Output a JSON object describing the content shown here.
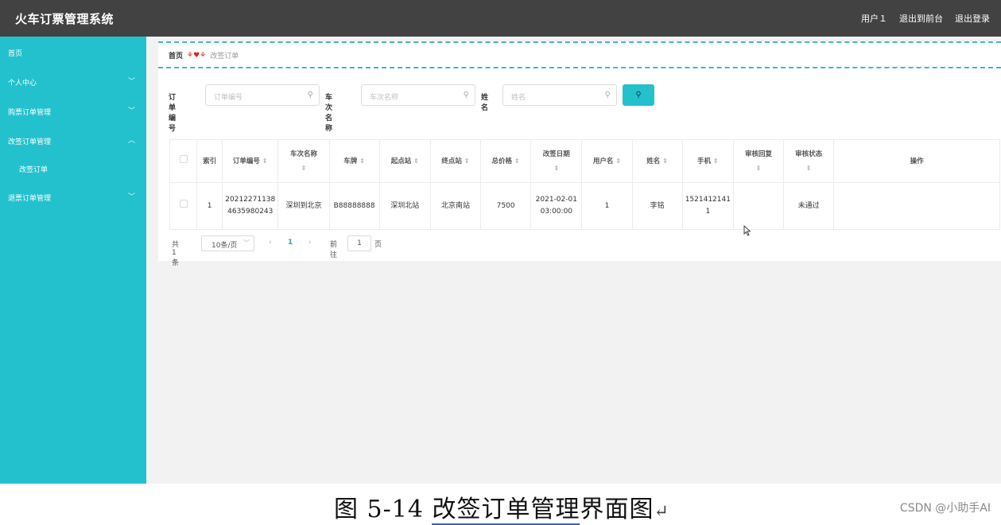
{
  "header": {
    "title": "火车订票管理系统",
    "links": [
      "用户１",
      "退出到前台",
      "退出登录"
    ]
  },
  "sidebar": {
    "items": [
      {
        "label": "首页",
        "chevron": ""
      },
      {
        "label": "个人中心",
        "chevron": "﹀"
      },
      {
        "label": "购票订单管理",
        "chevron": "﹀"
      },
      {
        "label": "改签订单管理",
        "chevron": "︿"
      },
      {
        "label": "改签订单",
        "chevron": ""
      },
      {
        "label": "退票订单管理",
        "chevron": "﹀"
      }
    ]
  },
  "breadcrumb": {
    "home": "首页",
    "separator": "⚘♥⚘",
    "current": "改签订单"
  },
  "search": {
    "order_no_label": "订单编号",
    "order_no_placeholder": "订单编号",
    "train_label": "车次名称",
    "train_placeholder": "车次名称",
    "name_label": "姓名",
    "name_placeholder": "姓名",
    "button_icon": "search-icon"
  },
  "table": {
    "headers": [
      "索引",
      "订单编号",
      "车次名称",
      "车牌",
      "起点站",
      "终点站",
      "总价格",
      "改签日期",
      "用户名",
      "姓名",
      "手机",
      "审核回复",
      "审核状态",
      "操作"
    ],
    "rows": [
      {
        "index": "1",
        "order_no": "20212271138463598024​3",
        "train": "深圳到北京",
        "plate": "B88888888",
        "from": "深圳北站",
        "to": "北京南站",
        "price": "7500",
        "date": "2021-02-01 03:00:00",
        "user": "1",
        "name": "李铭",
        "phone": "15214121411",
        "reply": "",
        "status": "未通过",
        "ops": ""
      }
    ]
  },
  "pager": {
    "total": "共 1 条",
    "page_size": "10条/页",
    "current_page": "1",
    "goto_label": "前往",
    "goto_value": "1",
    "page_suffix": "页"
  },
  "caption": {
    "prefix": "图 5-14 ",
    "underlined": "改签订单管理",
    "suffix": "界面图",
    "return_mark": "↵"
  },
  "watermark": "CSDN @小助手AI",
  "colors": {
    "topbar": "#424242",
    "sidebar": "#23c1cd",
    "accent": "#23c1cd",
    "dashed": "#3fb6d6"
  }
}
